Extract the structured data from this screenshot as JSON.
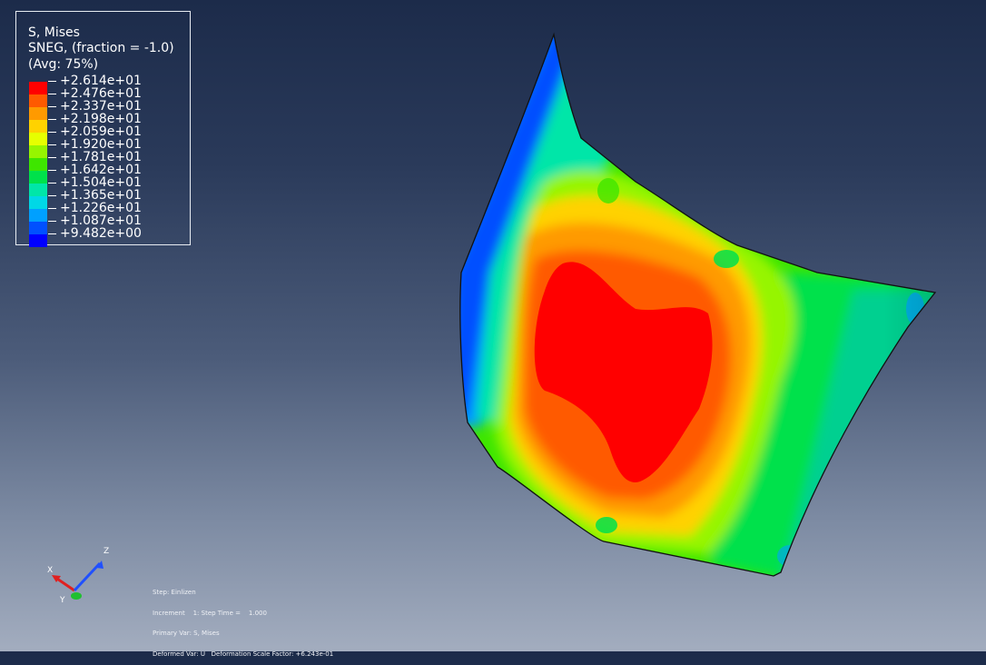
{
  "legend": {
    "title_1": "S, Mises",
    "title_2": "SNEG, (fraction = -1.0)",
    "title_3": "(Avg: 75%)",
    "levels": [
      {
        "label": "+2.614e+01",
        "color": "#ff0000"
      },
      {
        "label": "+2.476e+01",
        "color": "#ff5a00"
      },
      {
        "label": "+2.337e+01",
        "color": "#ff9a00"
      },
      {
        "label": "+2.198e+01",
        "color": "#ffd200"
      },
      {
        "label": "+2.059e+01",
        "color": "#e6ff00"
      },
      {
        "label": "+1.920e+01",
        "color": "#96f500"
      },
      {
        "label": "+1.781e+01",
        "color": "#3ee600"
      },
      {
        "label": "+1.642e+01",
        "color": "#00e14b"
      },
      {
        "label": "+1.504e+01",
        "color": "#00e6a8"
      },
      {
        "label": "+1.365e+01",
        "color": "#00d8e6"
      },
      {
        "label": "+1.226e+01",
        "color": "#00a0ff"
      },
      {
        "label": "+1.087e+01",
        "color": "#0050ff"
      },
      {
        "label": "+9.482e+00",
        "color": "#0000ff"
      }
    ]
  },
  "info": {
    "step": "Step: Einlizen",
    "increment": "Increment    1: Step Time =    1.000",
    "primary": "Primary Var: S, Mises",
    "deformed": "Deformed Var: U   Deformation Scale Factor: +6.243e-01"
  },
  "triad": {
    "x_label": "X",
    "y_label": "Y",
    "z_label": "Z",
    "x_color": "#e02020",
    "y_color": "#20c030",
    "z_color": "#2050ff"
  }
}
